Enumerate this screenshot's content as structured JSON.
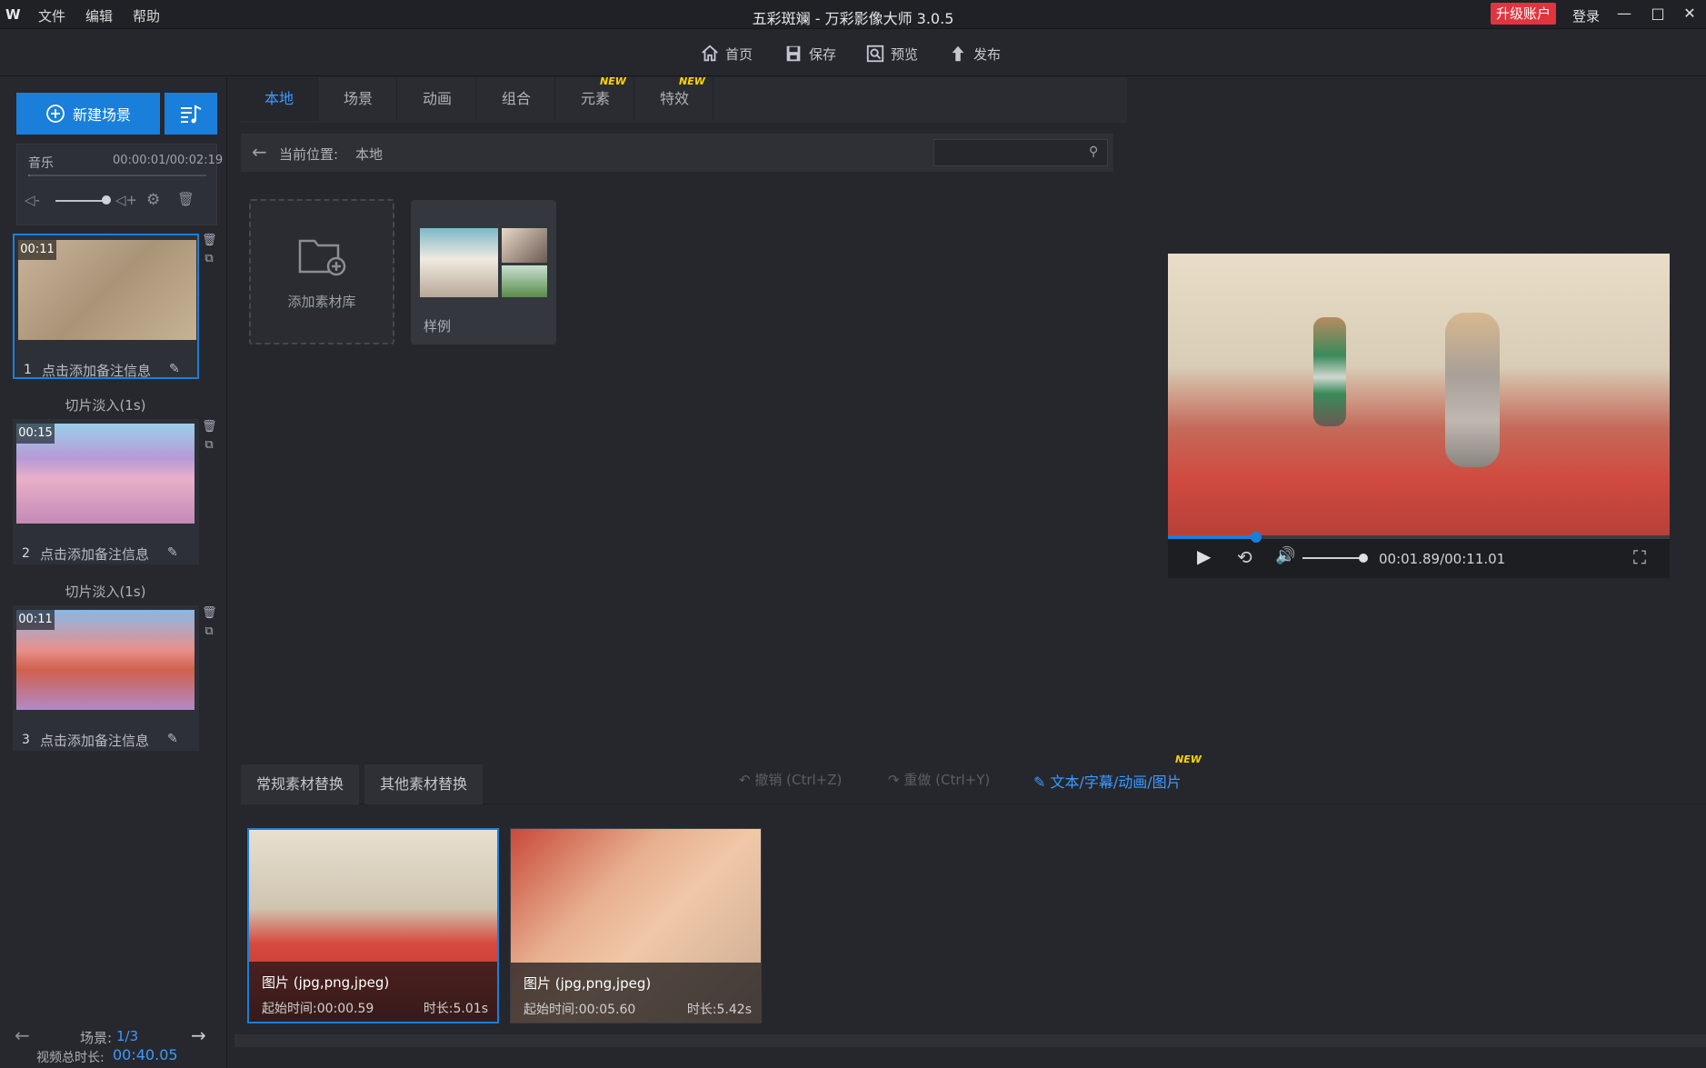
{
  "window": {
    "logo": "W",
    "title": "五彩斑斓 - 万彩影像大师 3.0.5",
    "menu": [
      "文件",
      "编辑",
      "帮助"
    ],
    "upgrade": "升级账户",
    "login": "登录",
    "controls": {
      "minimize": "—",
      "maximize": "□",
      "close": "✕"
    }
  },
  "toolbar": {
    "home": "首页",
    "save": "保存",
    "preview": "预览",
    "publish": "发布"
  },
  "left": {
    "new_scene": "新建场景",
    "music": {
      "label": "音乐",
      "time": "00:00:01/00:02:19",
      "progress": 0.01,
      "volume": 1.0
    },
    "scenes": [
      {
        "badge": "00:11",
        "num": "1",
        "note": "点击添加备注信息"
      },
      {
        "badge": "00:15",
        "num": "2",
        "note": "点击添加备注信息"
      },
      {
        "badge": "00:11",
        "num": "3",
        "note": "点击添加备注信息"
      }
    ],
    "transitions": [
      "切片淡入(1s)",
      "切片淡入(1s)"
    ],
    "nav": {
      "scene_label": "场景: ",
      "scene_value": "1/3",
      "total_label": "视频总时长: ",
      "total_value": "00:40.05"
    }
  },
  "center": {
    "tabs": [
      "本地",
      "场景",
      "动画",
      "组合",
      "元素",
      "特效"
    ],
    "new_tag": "NEW",
    "path_label": "当前位置:",
    "path_value": "本地",
    "search_placeholder": "",
    "add_library": "添加素材库",
    "folder_name": "样例"
  },
  "bottom": {
    "tabs": [
      "常规素材替换",
      "其他素材替换"
    ],
    "undo": "撤销 (Ctrl+Z)",
    "redo": "重做 (Ctrl+Y)",
    "text_tool": "文本/字幕/动画/图片",
    "new_tag": "NEW",
    "media": [
      {
        "type": "图片 (jpg,png,jpeg)",
        "start": "起始时间:00:00.59",
        "duration": "时长:5.01s"
      },
      {
        "type": "图片 (jpg,png,jpeg)",
        "start": "起始时间:00:05.60",
        "duration": "时长:5.42s"
      }
    ]
  },
  "preview": {
    "time": "00:01.89/00:11.01",
    "progress": 0.17,
    "volume": 1.0
  },
  "colors": {
    "accent": "#1a7fdb",
    "upgrade": "#e0353f",
    "new_tag": "#ffd400"
  }
}
